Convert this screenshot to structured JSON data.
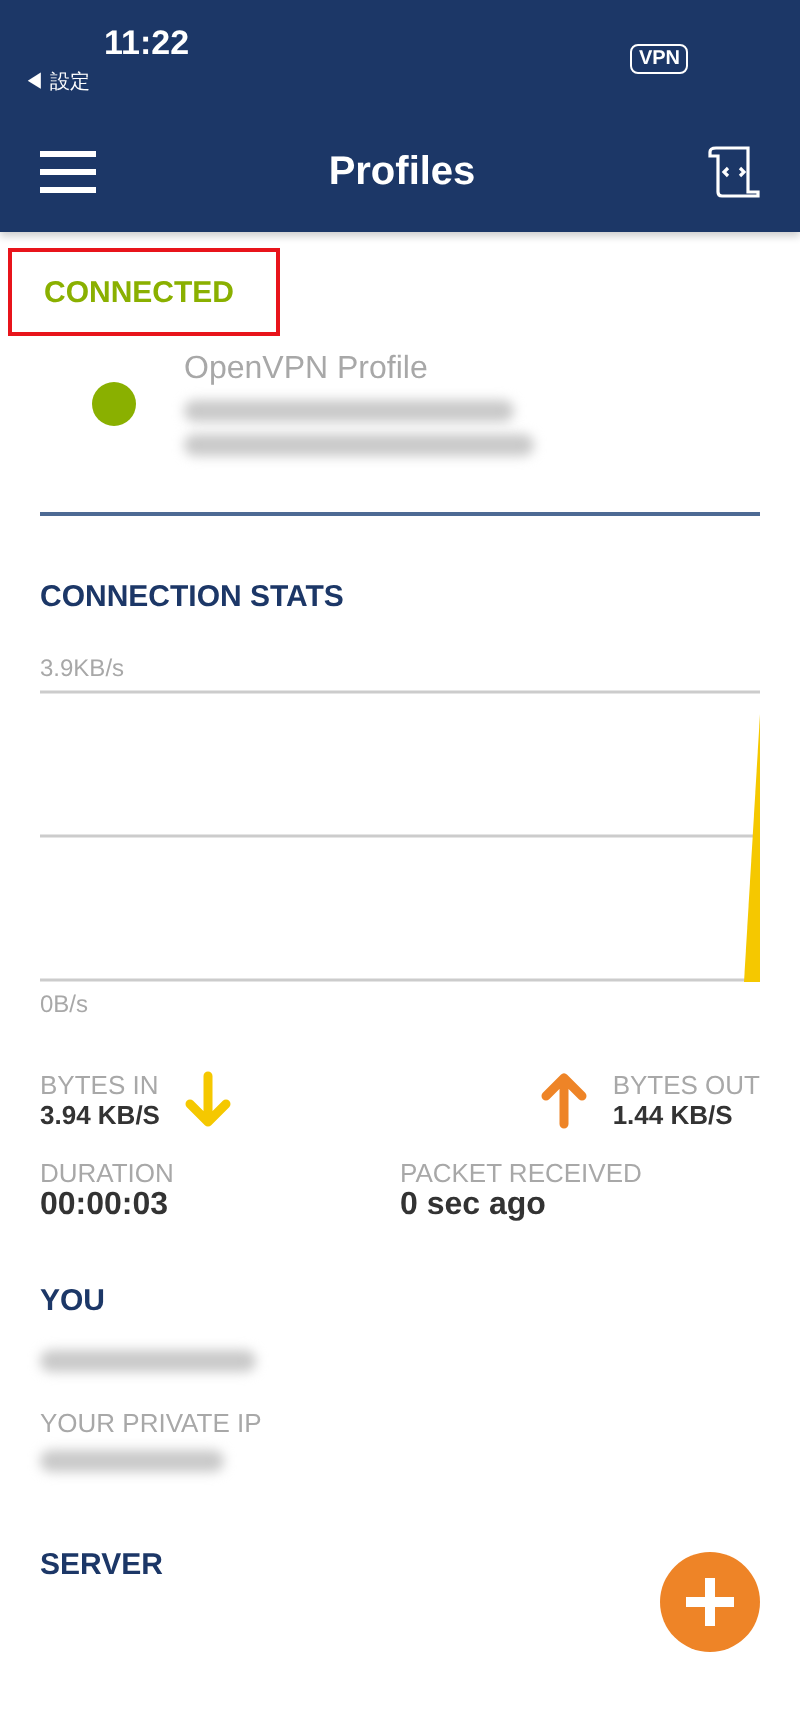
{
  "status_bar": {
    "time": "11:22",
    "back_label": "◀ 設定",
    "vpn_badge": "VPN"
  },
  "nav": {
    "title": "Profiles"
  },
  "connection": {
    "status": "CONNECTED",
    "highlighted": true,
    "color": "#8ab000"
  },
  "profile": {
    "name": "OpenVPN Profile",
    "details_blurred": true
  },
  "stats": {
    "title": "CONNECTION STATS",
    "chart": {
      "top_label": "3.9KB/s",
      "bottom_label": "0B/s"
    },
    "bytes_in": {
      "label": "BYTES IN",
      "value": "3.94 KB/S",
      "kind": "down",
      "color": "#f5c800"
    },
    "bytes_out": {
      "label": "BYTES OUT",
      "value": "1.44 KB/S",
      "kind": "up",
      "color": "#ee8427"
    },
    "duration": {
      "label": "DURATION",
      "value": "00:00:03"
    },
    "packet": {
      "label": "PACKET RECEIVED",
      "value": "0 sec ago"
    }
  },
  "you": {
    "title": "YOU",
    "private_ip_label": "YOUR PRIVATE IP"
  },
  "server": {
    "title": "SERVER"
  }
}
